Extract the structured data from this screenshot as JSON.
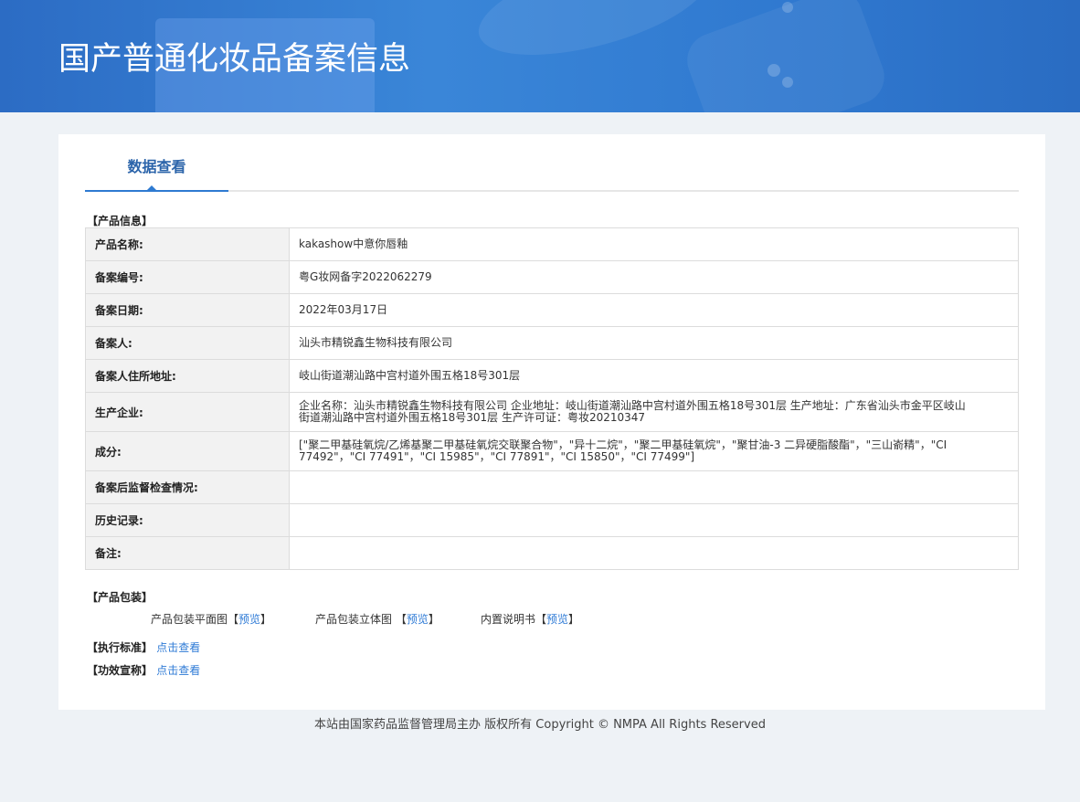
{
  "header": {
    "title": "国产普通化妆品备案信息"
  },
  "tabs": [
    {
      "label": "数据查看"
    }
  ],
  "product_info": {
    "section_label": "【产品信息】",
    "rows": [
      {
        "key": "产品名称:",
        "value": "kakashow中意你唇釉"
      },
      {
        "key": "备案编号:",
        "value": "粤G妆网备字2022062279"
      },
      {
        "key": "备案日期:",
        "value": "2022年03月17日"
      },
      {
        "key": "备案人:",
        "value": "汕头市精锐鑫生物科技有限公司"
      },
      {
        "key": "备案人住所地址:",
        "value": "岐山街道潮汕路中宫村道外围五格18号301层"
      },
      {
        "key": "生产企业:",
        "value": "企业名称：汕头市精锐鑫生物科技有限公司 企业地址：岐山街道潮汕路中宫村道外围五格18号301层 生产地址：广东省汕头市金平区岐山街道潮汕路中宫村道外围五格18号301层 生产许可证：粤妆20210347"
      },
      {
        "key": "成分:",
        "value": "[\"聚二甲基硅氧烷/乙烯基聚二甲基硅氧烷交联聚合物\"，\"异十二烷\"，\"聚二甲基硅氧烷\"，\"聚甘油-3 二异硬脂酸酯\"，\"三山嵛精\"，\"CI 77492\"，\"CI 77491\"，\"CI 15985\"，\"CI 77891\"，\"CI 15850\"，\"CI 77499\"]"
      },
      {
        "key": "备案后监督检查情况:",
        "value": ""
      },
      {
        "key": "历史记录:",
        "value": ""
      },
      {
        "key": "备注:",
        "value": ""
      }
    ]
  },
  "packaging": {
    "section_label": "【产品包装】",
    "items": [
      {
        "label": "产品包装平面图",
        "link": "预览"
      },
      {
        "label": "产品包装立体图 ",
        "link": "预览"
      },
      {
        "label": "内置说明书",
        "link": "预览"
      }
    ],
    "bracket_open": "【",
    "bracket_close": "】"
  },
  "standard": {
    "label": "【执行标准】",
    "link": "点击查看"
  },
  "efficacy": {
    "label": "【功效宣称】",
    "link": "点击查看"
  },
  "footer": {
    "text": "本站由国家药品监督管理局主办 版权所有 Copyright © NMPA All Rights Reserved"
  },
  "colors": {
    "header_blue": "#2f78cf",
    "accent": "#2b64aa",
    "link": "#2f7bd6"
  }
}
